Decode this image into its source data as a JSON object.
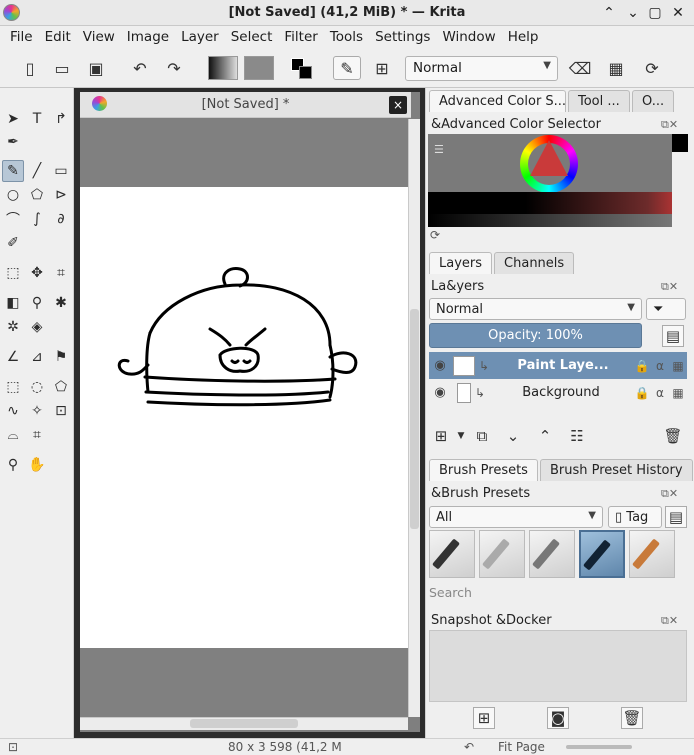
{
  "window": {
    "title": "[Not Saved]  (41,2 MiB)  * — Krita"
  },
  "menu": [
    "File",
    "Edit",
    "View",
    "Image",
    "Layer",
    "Select",
    "Filter",
    "Tools",
    "Settings",
    "Window",
    "Help"
  ],
  "toolbar": {
    "blend_mode": "Normal"
  },
  "document": {
    "tab_title": "[Not Saved]  *",
    "close_label": "×"
  },
  "dock": {
    "color_tabs": [
      "Advanced Color S...",
      "Tool ...",
      "O..."
    ],
    "color_panel_title": "&Advanced Color Selector",
    "layer_tabs": [
      "Layers",
      "Channels"
    ],
    "layers_panel_title": "La&yers",
    "layers_blend": "Normal",
    "opacity_label": "Opacity:  100%",
    "layers": [
      {
        "name": "Paint Laye...",
        "active": true
      },
      {
        "name": "Background",
        "active": false
      }
    ],
    "brush_tabs": [
      "Brush Presets",
      "Brush Preset History"
    ],
    "brush_panel_title": "&Brush Presets",
    "brush_filter": "All",
    "tag_label": "Tag",
    "search_placeholder": "Search",
    "snapshot_title": "Snapshot &Docker"
  },
  "status": {
    "size_text": "80 x 3 598 (41,2 M",
    "zoom_text": "Fit Page"
  }
}
